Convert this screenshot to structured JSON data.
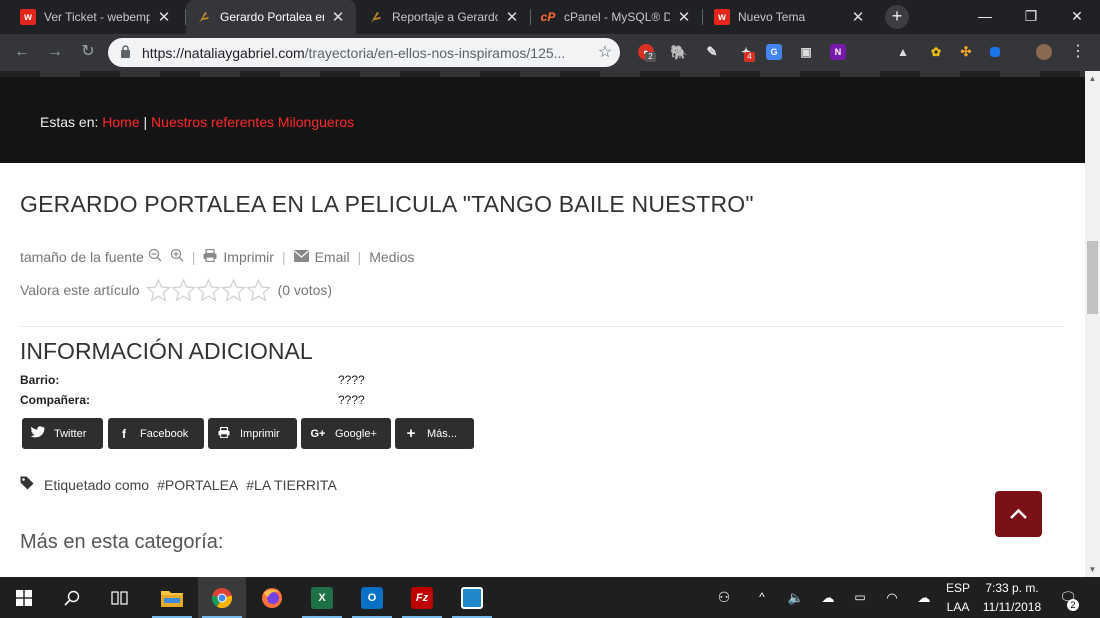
{
  "browser": {
    "tabs": [
      {
        "title": "Ver Ticket - webemp",
        "icon": "webempresa-icon",
        "fav_text": "w",
        "fav_color": "#e3261c"
      },
      {
        "title": "Gerardo Portalea en",
        "icon": "dancer-icon",
        "fav_text": "",
        "fav_color": "#c58b2a"
      },
      {
        "title": "Reportaje a Gerardo",
        "icon": "dancer-icon",
        "fav_text": "",
        "fav_color": "#c58b2a"
      },
      {
        "title": "cPanel - MySQL® Da",
        "icon": "cpanel-icon",
        "fav_text": "cP",
        "fav_color": "#ff6c2c"
      },
      {
        "title": "Nuevo Tema",
        "icon": "webempresa-icon",
        "fav_text": "w",
        "fav_color": "#e3261c"
      }
    ],
    "active_tab": 1,
    "url_host": "https://nataliaygabriel.com",
    "url_path": "/trayectoria/en-ellos-nos-inspiramos/125...",
    "extension_badges": [
      "2",
      "4"
    ]
  },
  "page": {
    "breadcrumb": {
      "prefix": "Estas en:",
      "home": "Home",
      "separator": "|",
      "section": "Nuestros referentes Milongueros"
    },
    "title": "GERARDO PORTALEA EN LA PELICULA \"TANGO BAILE NUESTRO\"",
    "tools": {
      "font_size_label": "tamaño de la fuente",
      "print": "Imprimir",
      "email": "Email",
      "media": "Medios"
    },
    "rating": {
      "label": "Valora este artículo",
      "votes": "(0 votos)",
      "value": 0,
      "max": 5
    },
    "info": {
      "heading": "INFORMACIÓN ADICIONAL",
      "rows": [
        {
          "label": "Barrio:",
          "value": "????"
        },
        {
          "label": "Compañera:",
          "value": "????"
        }
      ]
    },
    "share_buttons": [
      "Twitter",
      "Facebook",
      "Imprimir",
      "Google+",
      "Más..."
    ],
    "tags": {
      "label": "Etiquetado como",
      "items": [
        "#PORTALEA",
        "#LA TIERRITA"
      ]
    },
    "more_category": "Más en esta categoría:"
  },
  "taskbar": {
    "language": "ESP",
    "layout": "LAA",
    "time": "7:33 p. m.",
    "date": "11/11/2018",
    "notifications": "2"
  },
  "colors": {
    "accent_red": "#ff2a2a",
    "totop_bg": "#7a1118",
    "share_bg": "#2e2e2e"
  }
}
